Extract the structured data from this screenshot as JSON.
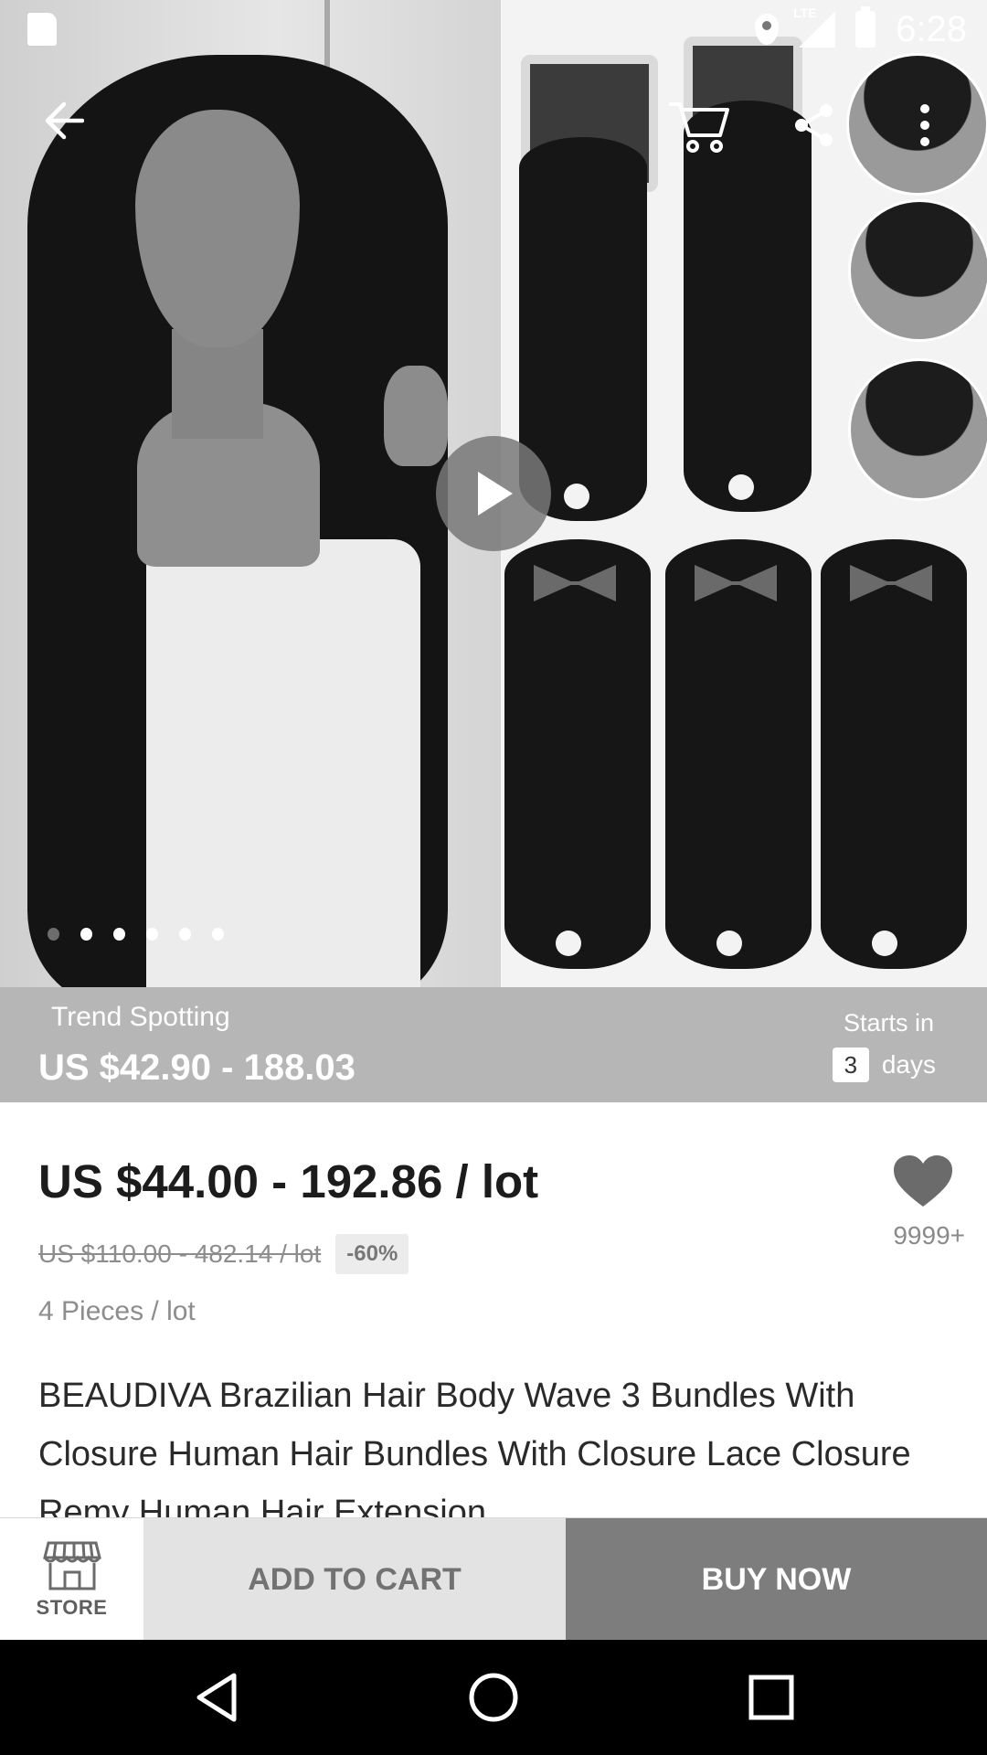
{
  "status_bar": {
    "time": "6:28",
    "network": "LTE"
  },
  "icons": {
    "back": "back-arrow-icon",
    "cart": "cart-icon",
    "share": "share-icon",
    "more": "more-vert-icon",
    "play": "play-icon",
    "wishlist": "heart-icon",
    "store": "store-icon"
  },
  "gallery": {
    "total_images": 6,
    "active_index": 0
  },
  "trend": {
    "label": "Trend Spotting",
    "price": "US $42.90 - 188.03",
    "starts_label": "Starts in",
    "days_count": "3",
    "days_label": "days"
  },
  "product": {
    "price": "US $44.00 - 192.86 / lot",
    "original_price": "US $110.00 - 482.14 / lot",
    "discount": "-60%",
    "unit": "4 Pieces / lot",
    "wishlist_count": "9999+",
    "title": "BEAUDIVA Brazilian Hair Body Wave 3 Bundles With Closure Human Hair Bundles With Closure Lace Closure Remy Human Hair Extension"
  },
  "actions": {
    "store_label": "STORE",
    "add_to_cart": "ADD TO CART",
    "buy_now": "BUY NOW"
  },
  "colors": {
    "trend_banner": "#b6b6b6",
    "buy_now": "#7d7d7d",
    "add_to_cart": "#e3e3e3"
  }
}
